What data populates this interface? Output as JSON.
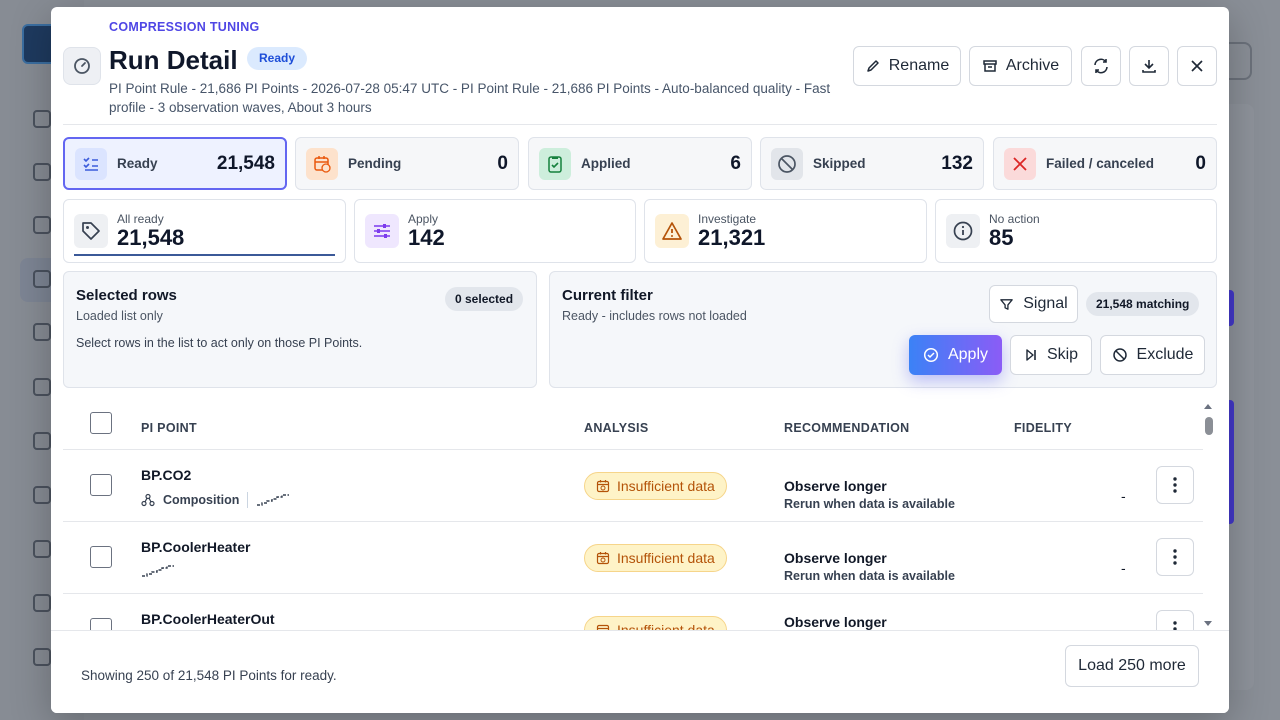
{
  "header": {
    "eyebrow": "COMPRESSION TUNING",
    "title": "Run Detail",
    "status_badge": "Ready",
    "subtitle": "PI Point Rule - 21,686 PI Points - 2026-07-28 05:47 UTC - PI Point Rule - 21,686 PI Points - Auto-balanced quality - Fast profile - 3 observation waves, About 3 hours",
    "rename_label": "Rename",
    "archive_label": "Archive"
  },
  "stats": [
    {
      "label": "Ready",
      "value": "21,548",
      "icon": "checklist-icon"
    },
    {
      "label": "Pending",
      "value": "0",
      "icon": "calendar-clock-icon"
    },
    {
      "label": "Applied",
      "value": "6",
      "icon": "clipboard-check-icon"
    },
    {
      "label": "Skipped",
      "value": "132",
      "icon": "ban-icon"
    },
    {
      "label": "Failed / canceled",
      "value": "0",
      "icon": "x-icon"
    }
  ],
  "metrics": [
    {
      "label": "All ready",
      "value": "21,548",
      "icon": "tag-icon"
    },
    {
      "label": "Apply",
      "value": "142",
      "icon": "sliders-icon"
    },
    {
      "label": "Investigate",
      "value": "21,321",
      "icon": "warning-icon"
    },
    {
      "label": "No action",
      "value": "85",
      "icon": "info-icon"
    }
  ],
  "selected_panel": {
    "title": "Selected rows",
    "subtitle": "Loaded list only",
    "count": "0 selected",
    "note": "Select rows in the list to act only on those PI Points."
  },
  "filter_panel": {
    "title": "Current filter",
    "subtitle": "Ready - includes rows not loaded",
    "signal_label": "Signal",
    "matching": "21,548 matching",
    "apply_label": "Apply",
    "skip_label": "Skip",
    "exclude_label": "Exclude"
  },
  "table": {
    "columns": [
      "PI POINT",
      "ANALYSIS",
      "RECOMMENDATION",
      "FIDELITY"
    ],
    "rows": [
      {
        "name": "BP.CO2",
        "tag": "Composition",
        "analysis": "Insufficient data",
        "rec_title": "Observe longer",
        "rec_sub": "Rerun when data is available",
        "fidelity": "-"
      },
      {
        "name": "BP.CoolerHeater",
        "tag": "",
        "analysis": "Insufficient data",
        "rec_title": "Observe longer",
        "rec_sub": "Rerun when data is available",
        "fidelity": "-"
      },
      {
        "name": "BP.CoolerHeaterOut",
        "tag": "",
        "analysis": "Insufficient data",
        "rec_title": "Observe longer",
        "rec_sub": "",
        "fidelity": ""
      }
    ]
  },
  "footer": {
    "showing": "Showing 250 of 21,548 PI Points for ready.",
    "load_more": "Load 250 more"
  },
  "colors": {
    "accent": "#4f46e5",
    "active_border": "#6366f1",
    "warning_bg": "#fef3c7",
    "warning_text": "#b45309"
  }
}
